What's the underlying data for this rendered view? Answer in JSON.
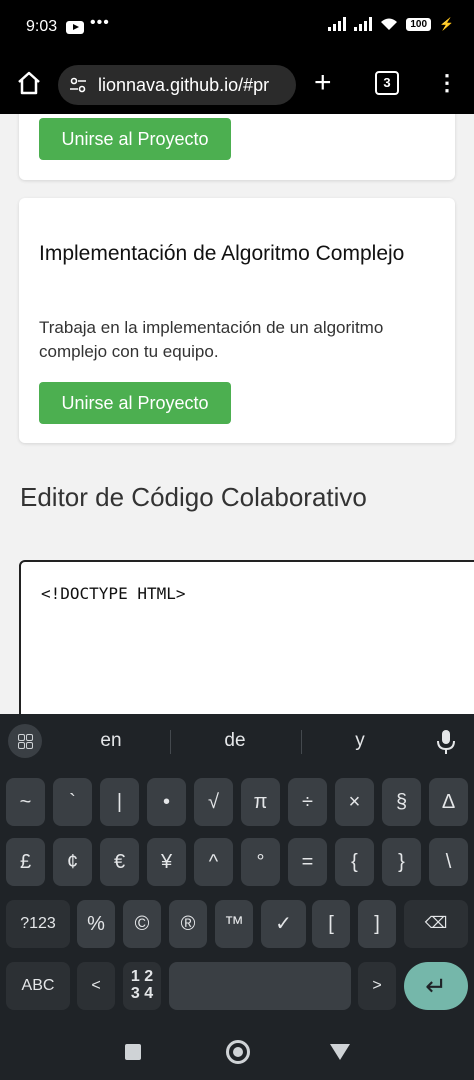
{
  "status_bar": {
    "time": "9:03",
    "dots": "•••",
    "battery": "100"
  },
  "browser": {
    "url": "lionnava.github.io/#pr",
    "tab_count": "3",
    "new_tab": "+",
    "menu": "⋮"
  },
  "cards": [
    {
      "button": "Unirse al Proyecto"
    },
    {
      "title": "Implementación de Algoritmo Complejo",
      "description": "Trabaja en la implementación de un algoritmo complejo con tu equipo.",
      "button": "Unirse al Proyecto"
    }
  ],
  "section_title": "Editor de Código Colaborativo",
  "editor": {
    "text": "<!DOCTYPE HTML>"
  },
  "keyboard": {
    "suggestions": [
      "en",
      "de",
      "y"
    ],
    "row1": [
      "~",
      "`",
      "|",
      "•",
      "√",
      "π",
      "÷",
      "×",
      "§",
      "Δ"
    ],
    "row2": [
      "£",
      "¢",
      "€",
      "¥",
      "^",
      "°",
      "=",
      "{",
      "}",
      "\\"
    ],
    "row3": [
      "?123",
      "%",
      "©",
      "®",
      "™",
      "✓",
      "[",
      "]",
      "⌫"
    ],
    "row4": {
      "abc": "ABC",
      "lt": "<",
      "num_top": "1 2",
      "num_bottom": "3 4",
      "space": "",
      "gt": ">",
      "enter": "↵"
    }
  }
}
